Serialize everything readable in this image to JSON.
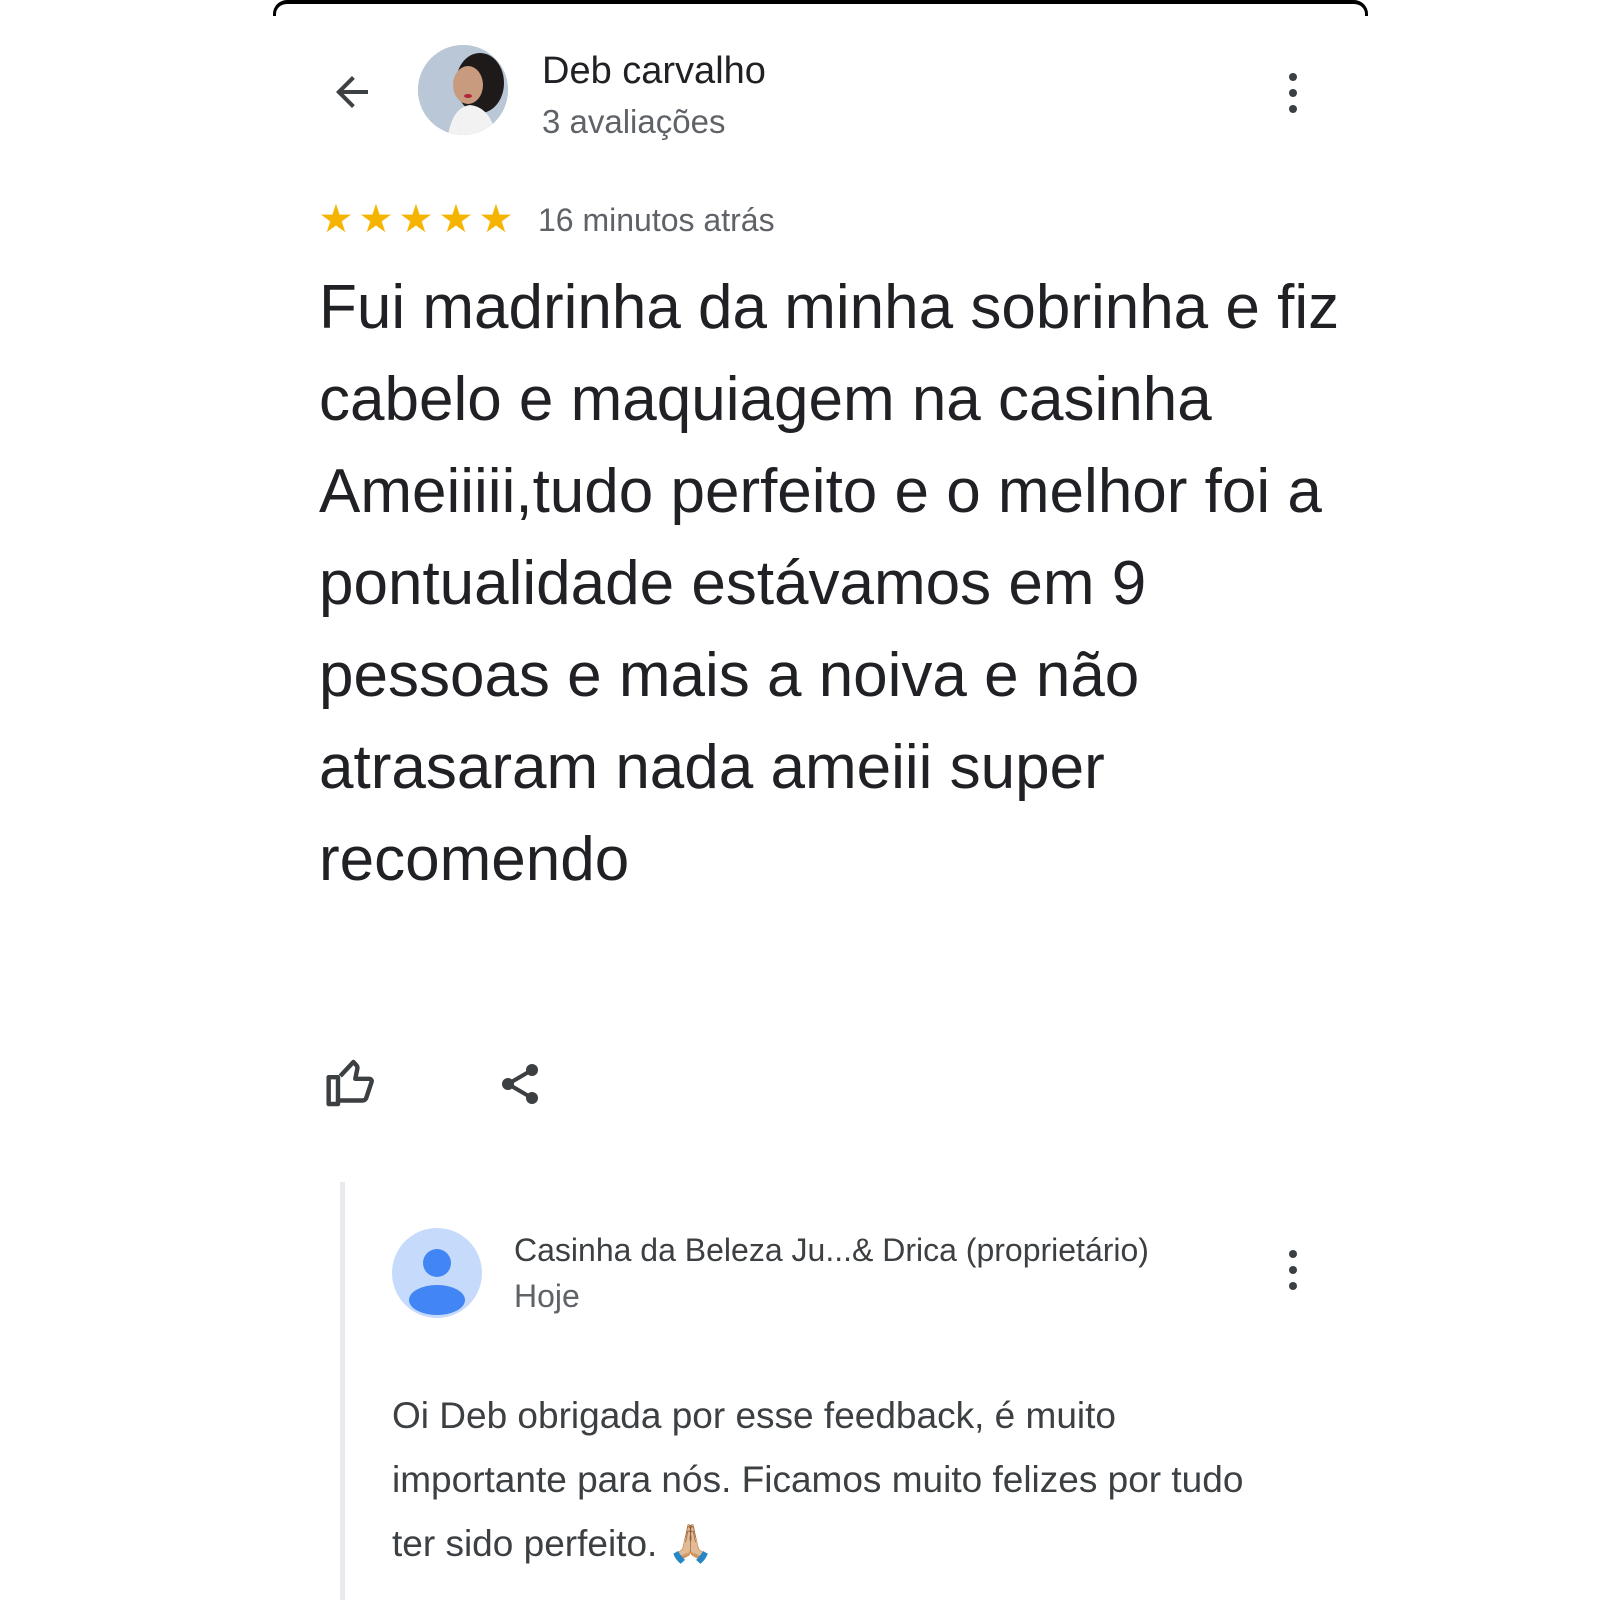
{
  "header": {
    "back_icon": "arrow-back-icon",
    "reviewer_name": "Deb carvalho",
    "reviewer_meta": "3 avaliações",
    "more_icon": "more-vert-icon"
  },
  "review": {
    "rating": 5,
    "rating_max": 5,
    "star_color": "#f4b400",
    "star_glyph": "★",
    "time": "16 minutos atrás",
    "text": "Fui madrinha da minha sobrinha e fiz cabelo e maquiagem na casinha\nAmeiiiii,tudo perfeito e o melhor foi a pontualidade estávamos em 9 pessoas e mais a noiva e não atrasaram nada ameiii super recomendo"
  },
  "actions": {
    "like_icon": "thumbs-up-icon",
    "share_icon": "share-icon"
  },
  "owner_reply": {
    "name": "Casinha da Beleza Ju...& Drica (proprietário)",
    "date": "Hoje",
    "text": "Oi Deb obrigada por esse feedback, é muito importante para nós. Ficamos muito felizes por tudo ter sido perfeito.",
    "emoji": "🙏🏼",
    "avatar_icon": "person-icon",
    "avatar_color": "#c6dafc",
    "avatar_figure_color": "#4285f4"
  }
}
